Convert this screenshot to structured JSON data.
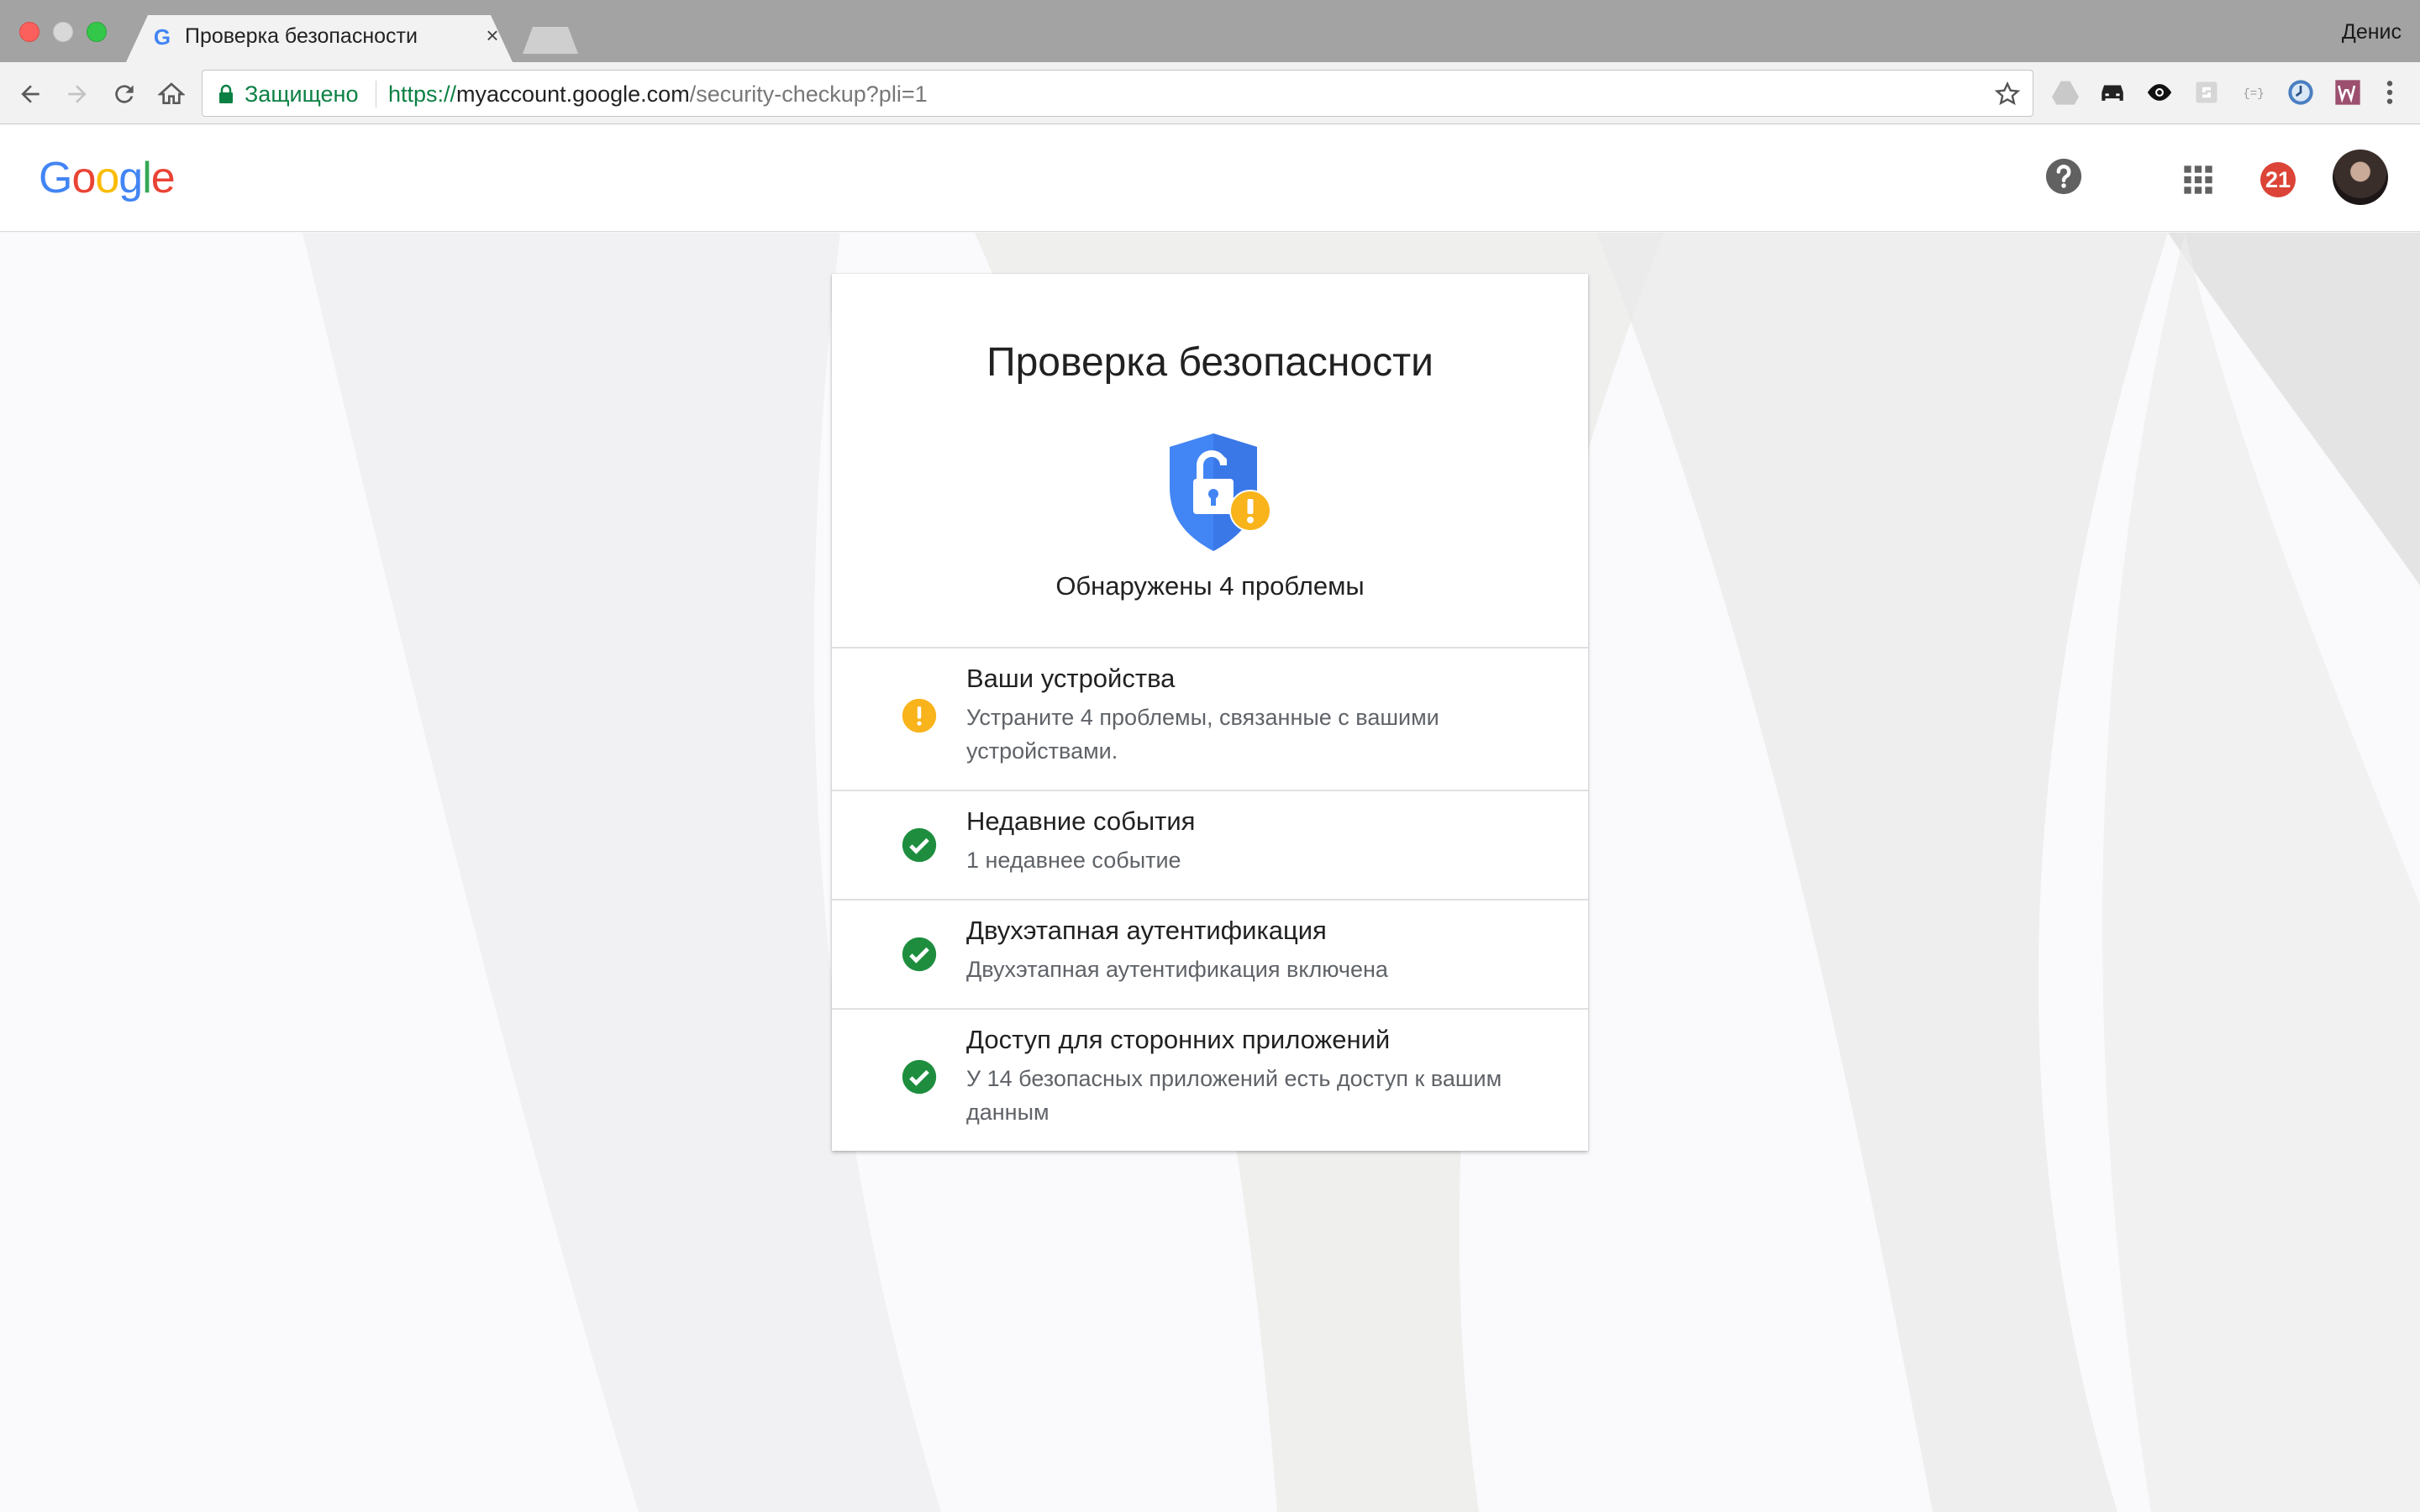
{
  "browser": {
    "tab_title": "Проверка безопасности",
    "tab_favicon": "G",
    "tab_close": "×",
    "profile_name": "Денис",
    "secure_label": "Защищено",
    "url_scheme": "https://",
    "url_host": "myaccount.google.com",
    "url_path": "/security-checkup?pli=1"
  },
  "header": {
    "logo_letters": [
      "G",
      "o",
      "o",
      "g",
      "l",
      "e"
    ],
    "logo_colors": [
      "#4285f4",
      "#ea4335",
      "#fbbc05",
      "#4285f4",
      "#34a853",
      "#ea4335"
    ],
    "notification_count": "21"
  },
  "card": {
    "title": "Проверка безопасности",
    "subtitle": "Обнаружены 4 проблемы",
    "items": [
      {
        "status": "warning",
        "icon": "warning-icon",
        "title": "Ваши устройства",
        "description": "Устраните 4 проблемы, связанные с вашими устройствами."
      },
      {
        "status": "ok",
        "icon": "check-icon",
        "title": "Недавние события",
        "description": "1 недавнее событие"
      },
      {
        "status": "ok",
        "icon": "check-icon",
        "title": "Двухэтапная аутентификация",
        "description": "Двухэтапная аутентификация включена"
      },
      {
        "status": "ok",
        "icon": "check-icon",
        "title": "Доступ для сторонних приложений",
        "description": "У 14 безопасных приложений есть доступ к вашим данным"
      }
    ]
  },
  "colors": {
    "warning": "#f9b31b",
    "ok": "#1e8e3e",
    "shield": "#4285f4",
    "secure": "#0b8043"
  }
}
